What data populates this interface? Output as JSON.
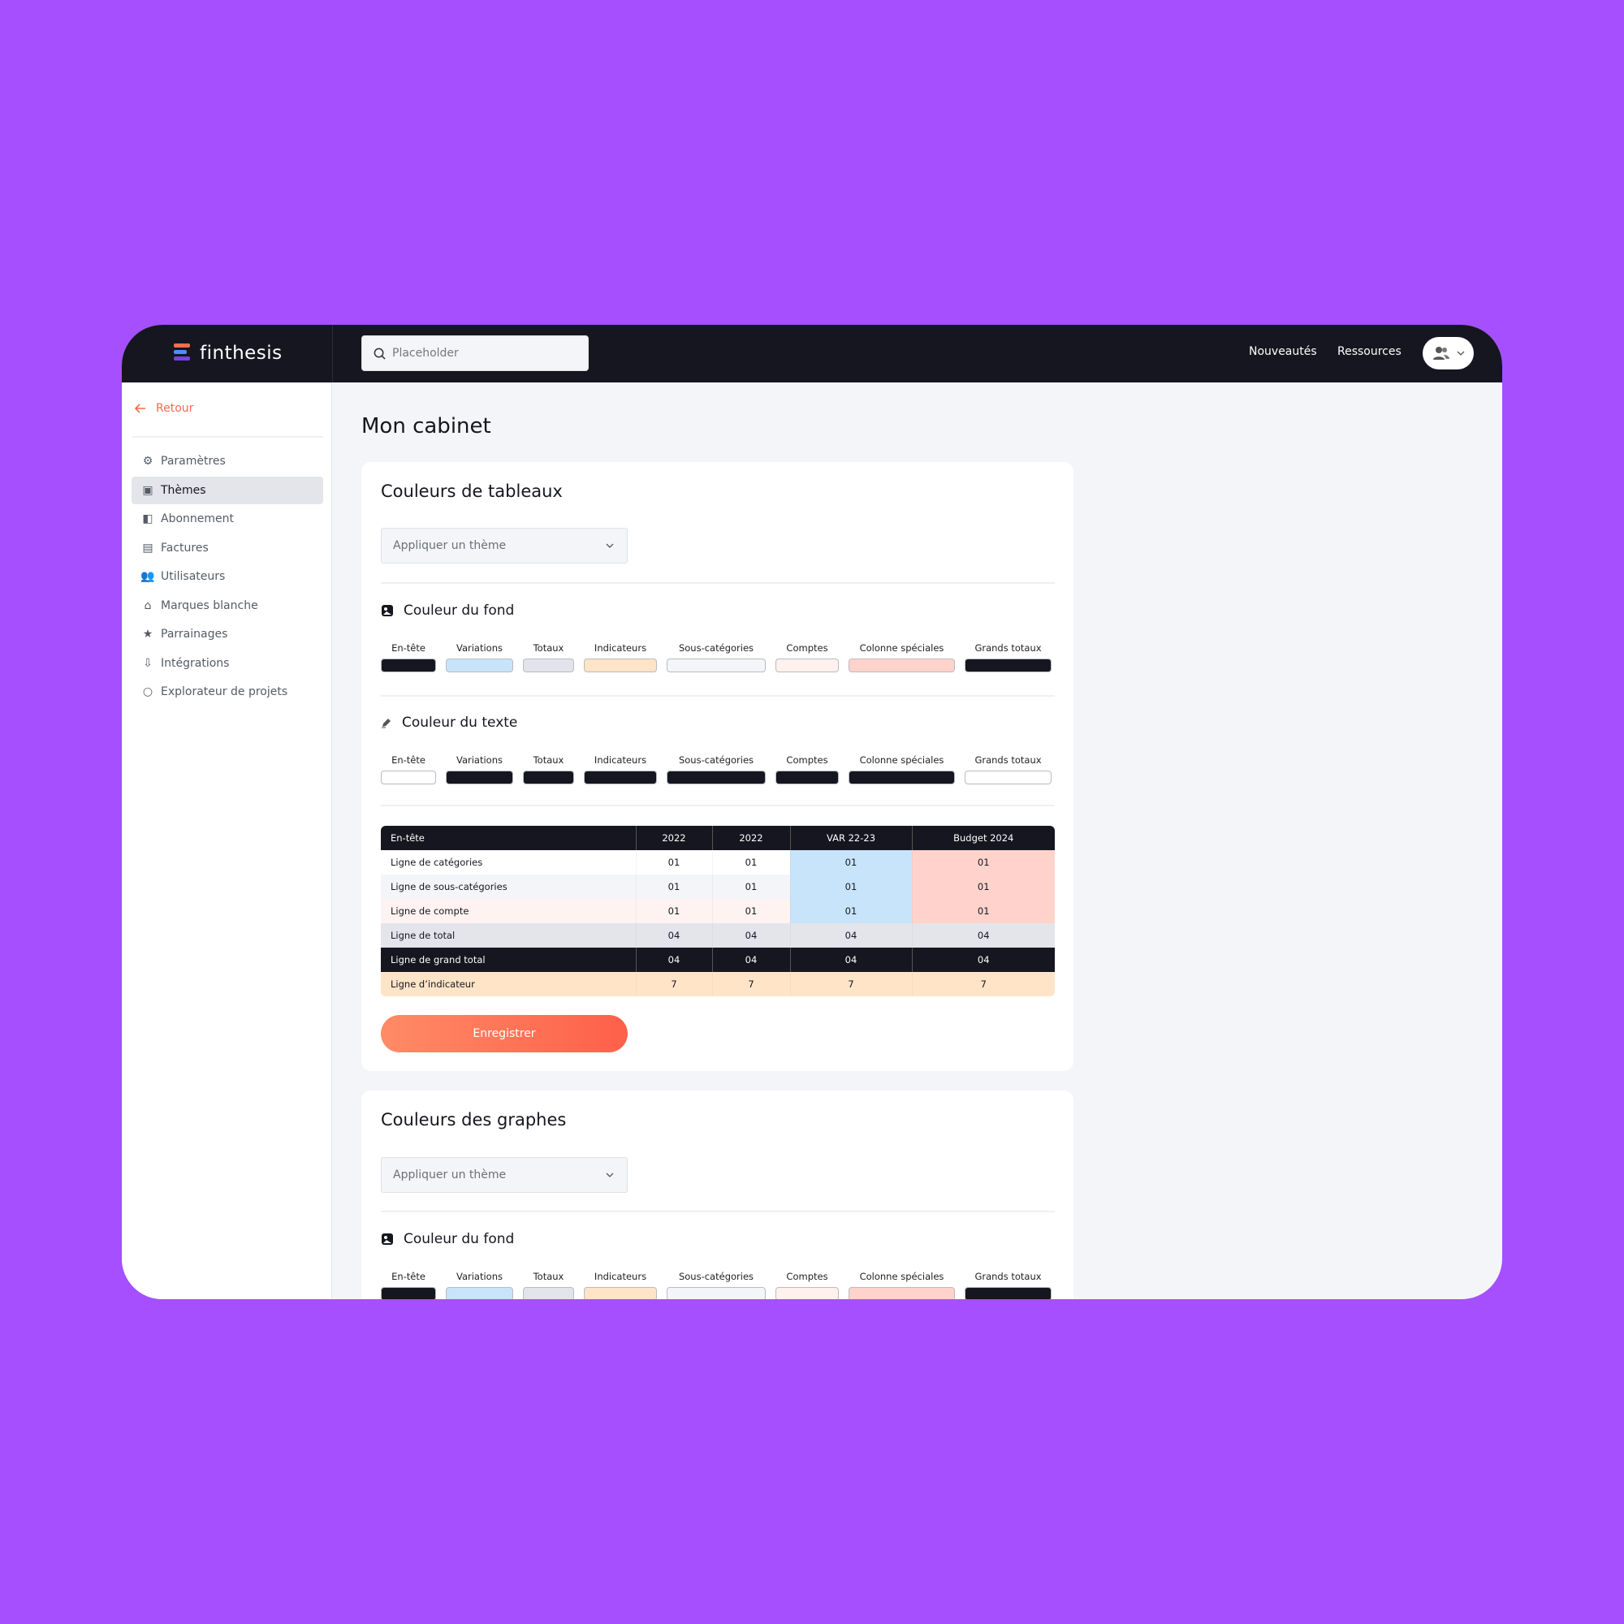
{
  "app": {
    "logo": "finthesis",
    "search_placeholder": "Placeholder",
    "nav": [
      "Nouveautés",
      "Ressources"
    ]
  },
  "sidebar": {
    "back": "Retour",
    "items": [
      {
        "label": "Paramètres",
        "icon": "gear-icon"
      },
      {
        "label": "Thèmes",
        "icon": "image-icon",
        "active": true
      },
      {
        "label": "Abonnement",
        "icon": "wallet-icon"
      },
      {
        "label": "Factures",
        "icon": "document-icon"
      },
      {
        "label": "Utilisateurs",
        "icon": "users-icon"
      },
      {
        "label": "Marques blanche",
        "icon": "home-icon"
      },
      {
        "label": "Parrainages",
        "icon": "star-icon"
      },
      {
        "label": "Intégrations",
        "icon": "download-icon"
      },
      {
        "label": "Explorateur de projets",
        "icon": "search-icon"
      }
    ]
  },
  "main": {
    "title": "Mon cabinet",
    "tables_section": {
      "title": "Couleurs de tableaux",
      "dropdown": "Appliquer un thème",
      "bg_title": "Couleur du fond",
      "text_title": "Couleur du texte",
      "save": "Enregistrer"
    },
    "graphs_section": {
      "title": "Couleurs des graphes",
      "dropdown": "Appliquer un thème",
      "bg_title": "Couleur du fond"
    }
  },
  "swatch_labels": [
    "En-tête",
    "Variations",
    "Totaux",
    "Indicateurs",
    "Sous-catégories",
    "Comptes",
    "Colonne spéciales",
    "Grands totaux"
  ],
  "bg_colors": [
    "#15161F",
    "#C7E4FB",
    "#E2E4E9",
    "#FFE4C8",
    "#F4F5F8",
    "#FFF1EE",
    "#FFD3CC",
    "#15161F"
  ],
  "text_colors": [
    "#FFFFFF",
    "#15161F",
    "#15161F",
    "#15161F",
    "#15161F",
    "#15161F",
    "#15161F",
    "#FFFFFF"
  ],
  "preview": {
    "headers": [
      "En-tête",
      "2022",
      "2022",
      "VAR 22-23",
      "Budget 2024"
    ],
    "rows": [
      {
        "label": "Ligne de catégories",
        "values": [
          "01",
          "01",
          "01",
          "01"
        ],
        "bg": "#FFFFFF",
        "fg": "#15161F"
      },
      {
        "label": "Ligne de sous-catégories",
        "values": [
          "01",
          "01",
          "01",
          "01"
        ],
        "bg": "#F4F5F8",
        "fg": "#15161F"
      },
      {
        "label": "Ligne de compte",
        "values": [
          "01",
          "01",
          "01",
          "01"
        ],
        "bg": "#FFF3F1",
        "fg": "#15161F"
      },
      {
        "label": "Ligne de total",
        "values": [
          "04",
          "04",
          "04",
          "04"
        ],
        "bg": "#E3E5EA",
        "fg": "#15161F"
      },
      {
        "label": "Ligne de grand total",
        "values": [
          "04",
          "04",
          "04",
          "04"
        ],
        "bg": "#15161F",
        "fg": "#FFFFFF"
      },
      {
        "label": "Ligne d’indicateur",
        "values": [
          "7",
          "7",
          "7",
          "7"
        ],
        "bg": "#FFE4C8",
        "fg": "#15161F"
      }
    ],
    "variation_color": "#C7E4FB",
    "special_color": "#FFD3CC"
  }
}
